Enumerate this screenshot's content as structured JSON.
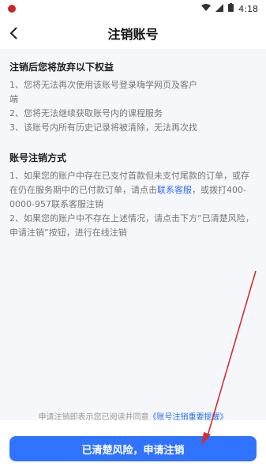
{
  "status_bar": {
    "time": "4:18",
    "colors": {
      "app_dot": "#c62828"
    }
  },
  "header": {
    "title": "注销账号"
  },
  "section1": {
    "title": "注销后您将放弃以下权益",
    "items": [
      {
        "line1": "1、您将无法再次使用该账号登录嗨学网页及客户",
        "line2": "端"
      },
      {
        "line1": "2、您将无法继续获取账号内的课程服务"
      },
      {
        "line1": "3、该账号内所有历史记录将被清除，无法再次找"
      }
    ]
  },
  "section2": {
    "title": "账号注销方式",
    "items": [
      {
        "line1": "1、如果您的账户中存在已支付首款但未支付尾款的订单，或存",
        "line2_prefix": "在仍在服务期中的已付款订单，请点击",
        "link": "联系客服",
        "line2_suffix": "，或拨打400-",
        "line3": "0000-957联系客服注销"
      },
      {
        "line1": "2、如果您的账户中不存在上述情况，请点击下方“已清楚风险，",
        "line2": "申请注销”按钮，进行在线注销"
      }
    ]
  },
  "agreement": {
    "text": "申请注销即表示您已阅读并同意",
    "link": "《账号注销重要提醒》"
  },
  "primary_button": {
    "label": "已清楚风险，申请注销"
  },
  "colors": {
    "accent": "#2f73ff",
    "link": "#2a6df0",
    "annotation_arrow": "#d32f2f"
  }
}
